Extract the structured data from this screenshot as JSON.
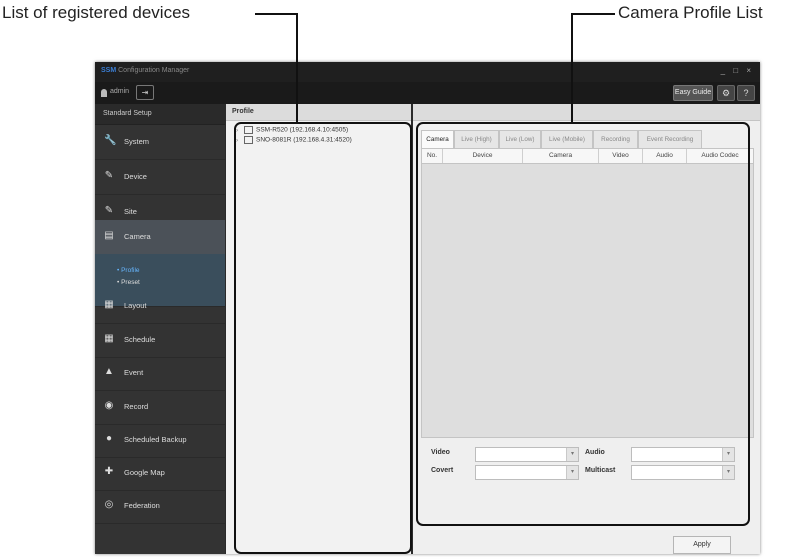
{
  "callouts": {
    "left": "List of registered devices",
    "right": "Camera Profile List"
  },
  "app": {
    "title_brand": "SSM",
    "title_rest": "Configuration Manager",
    "window_controls": "_ □ ×",
    "user": "admin",
    "logout_icon": "⇥",
    "easy_guide": "Easy Guide",
    "gear_icon": "⚙",
    "help_icon": "?"
  },
  "sidebar": {
    "header": "Standard Setup",
    "items": [
      {
        "label": "System",
        "icon": "🔧"
      },
      {
        "label": "Device",
        "icon": "✎"
      },
      {
        "label": "Site",
        "icon": "✎"
      },
      {
        "label": "Camera",
        "icon": "▤"
      },
      {
        "label": "Layout",
        "icon": "▦"
      },
      {
        "label": "Schedule",
        "icon": "▦"
      },
      {
        "label": "Event",
        "icon": "▲"
      },
      {
        "label": "Record",
        "icon": "◉"
      },
      {
        "label": "Scheduled Backup",
        "icon": "●"
      },
      {
        "label": "Google Map",
        "icon": "✚"
      },
      {
        "label": "Federation",
        "icon": "◎"
      }
    ],
    "camera_sub": [
      {
        "label": "• Profile"
      },
      {
        "label": "• Preset"
      }
    ]
  },
  "profile": {
    "header": "Profile",
    "devices": [
      "SSM-R520 (192.168.4.10:4505)",
      "SNO-8081R (192.168.4.31:4520)"
    ]
  },
  "tabs": [
    "Camera",
    "Live (High)",
    "Live (Low)",
    "Live (Mobile)",
    "Recording",
    "Event Recording"
  ],
  "table": {
    "columns": [
      "No.",
      "Device",
      "Camera",
      "Video",
      "Audio",
      "Audio Codec"
    ]
  },
  "form": {
    "video_label": "Video",
    "audio_label": "Audio",
    "covert_label": "Covert",
    "multicast_label": "Multicast",
    "dropdown_icon": "▾"
  },
  "apply": "Apply"
}
